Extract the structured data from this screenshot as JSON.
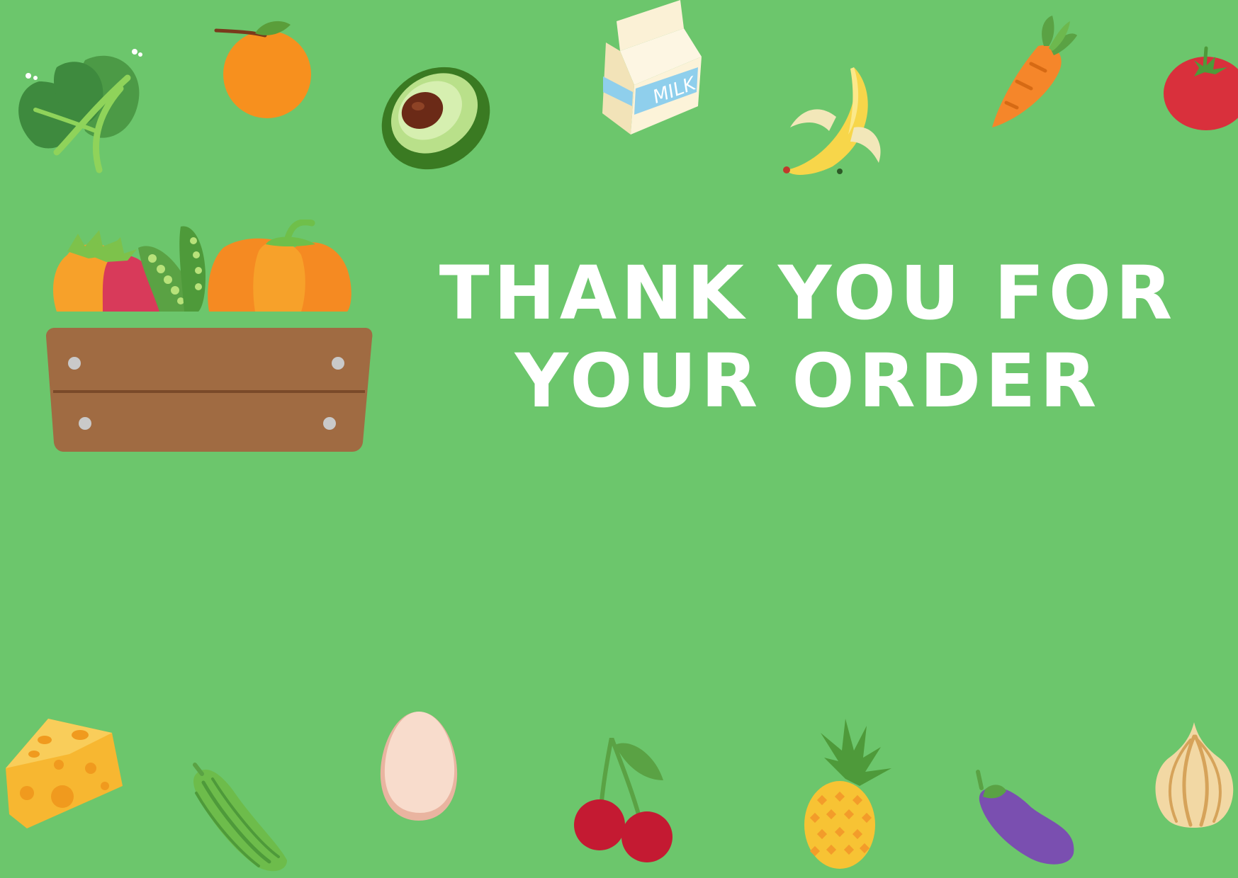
{
  "card": {
    "background": "#6cc66c",
    "headline": {
      "line1": "THANK YOU FOR",
      "line2": "YOUR ORDER",
      "color": "#ffffff"
    }
  },
  "icons": {
    "top": [
      "leafy-greens-icon",
      "orange-icon",
      "avocado-icon",
      "milk-carton-icon",
      "banana-icon",
      "carrot-icon",
      "tomato-icon"
    ],
    "bottom": [
      "cheese-icon",
      "cucumber-icon",
      "egg-icon",
      "cherries-icon",
      "pineapple-icon",
      "eggplant-icon",
      "onion-icon"
    ],
    "center": [
      "produce-crate-icon"
    ]
  },
  "milk_label": "MILK"
}
